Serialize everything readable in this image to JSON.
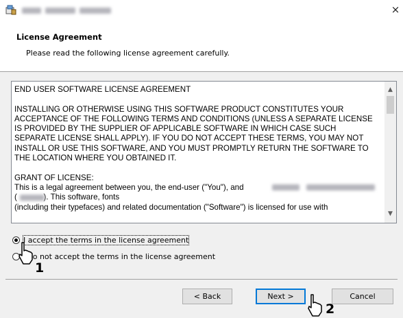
{
  "window": {
    "title_bar_text_blurred": "",
    "close_glyph": "×"
  },
  "header": {
    "title": "License Agreement",
    "subtitle": "Please read the following license agreement carefully."
  },
  "license": {
    "text": "END USER SOFTWARE LICENSE AGREEMENT\n\nINSTALLING OR OTHERWISE USING THIS SOFTWARE PRODUCT CONSTITUTES YOUR\nACCEPTANCE OF THE FOLLOWING TERMS AND CONDITIONS (UNLESS A SEPARATE LICENSE\nIS PROVIDED BY THE SUPPLIER OF APPLICABLE SOFTWARE IN WHICH CASE SUCH\nSEPARATE LICENSE SHALL APPLY). IF YOU DO NOT ACCEPT THESE TERMS, YOU MAY NOT\nINSTALL OR USE THIS SOFTWARE, AND YOU MUST PROMPTLY RETURN THE SOFTWARE TO\nTHE LOCATION WHERE YOU OBTAINED IT.\n\nGRANT OF LICENSE:\nThis is a legal agreement between you, the end-user (\"You\"), and\n(            ). This software, fonts\n(including their typefaces) and related documentation (\"Software\") is licensed for use with"
  },
  "options": {
    "accept_label": "I accept the terms in the license agreement",
    "decline_label": "I do not accept the terms in the license agreement",
    "selected": "accept"
  },
  "buttons": {
    "back": "< Back",
    "next": "Next >",
    "cancel": "Cancel"
  },
  "callouts": {
    "step1": "1",
    "step2": "2"
  },
  "colors": {
    "accent": "#0078d7",
    "background": "#f0f0f0"
  }
}
